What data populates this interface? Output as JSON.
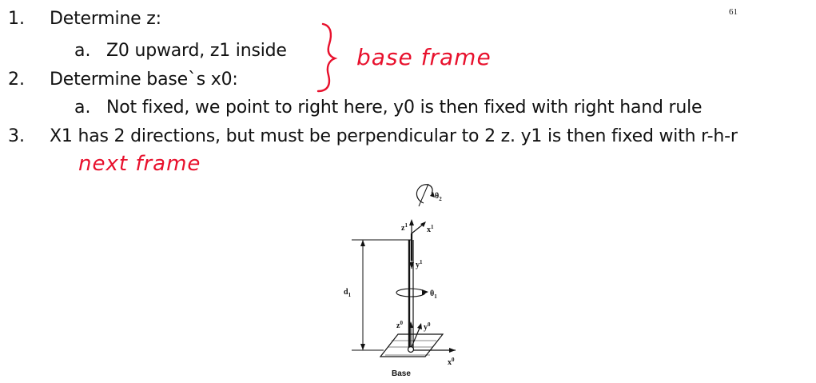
{
  "page_number": "61",
  "items": [
    {
      "num": "1.",
      "text": "Determine z:"
    },
    {
      "num": "a.",
      "text": "Z0 upward, z1 inside"
    },
    {
      "num": "2.",
      "text": "Determine base`s x0:"
    },
    {
      "num": "a.",
      "text": "Not fixed, we point to right here, y0 is then fixed with right hand rule"
    },
    {
      "num": "3.",
      "text": "X1 has 2 directions, but must be perpendicular to 2 z. y1 is then fixed with r-h-r"
    }
  ],
  "annotations": {
    "base_frame": "base frame",
    "next_frame": "next frame",
    "ink_color": "#e8112d"
  },
  "diagram": {
    "labels": {
      "theta2": "θ",
      "theta2_sub": "2",
      "theta1": "θ",
      "theta1_sub": "1",
      "z1": "z",
      "z1_sup": "1",
      "x1": "x",
      "x1_sup": "1",
      "y1": "y",
      "y1_sup": "1",
      "d1": "d",
      "d1_sub": "1",
      "z0": "z",
      "z0_sup": "0",
      "y0": "y",
      "y0_sup": "0",
      "x0": "x",
      "x0_sup": "0",
      "base": "Base"
    }
  }
}
